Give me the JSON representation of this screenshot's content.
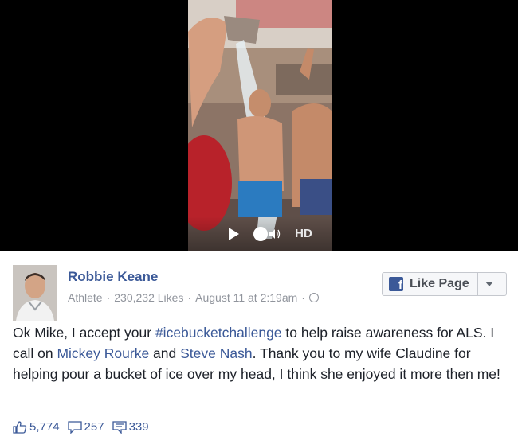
{
  "video": {
    "hd_label": "HD",
    "play_icon": "play-icon",
    "volume_icon": "volume-icon"
  },
  "post": {
    "author": "Robbie Keane",
    "category": "Athlete",
    "likes": "230,232 Likes",
    "timestamp": "August 11 at 2:19am",
    "like_page_label": "Like Page",
    "text": {
      "part1": "Ok Mike, I accept your ",
      "hashtag": "#icebucketchallenge",
      "part2": " to help raise awareness for ALS. I call on ",
      "mention1": "Mickey Rourke",
      "part3": " and ",
      "mention2": "Steve Nash",
      "part4": ". Thank you to my wife Claudine for helping pour a bucket of ice over my head, I think she enjoyed it more then me!"
    },
    "stats": {
      "likes": "5,774",
      "comments": "257",
      "shares": "339"
    }
  },
  "colors": {
    "link": "#3b5998",
    "meta": "#90949c",
    "text": "#1d2129"
  }
}
